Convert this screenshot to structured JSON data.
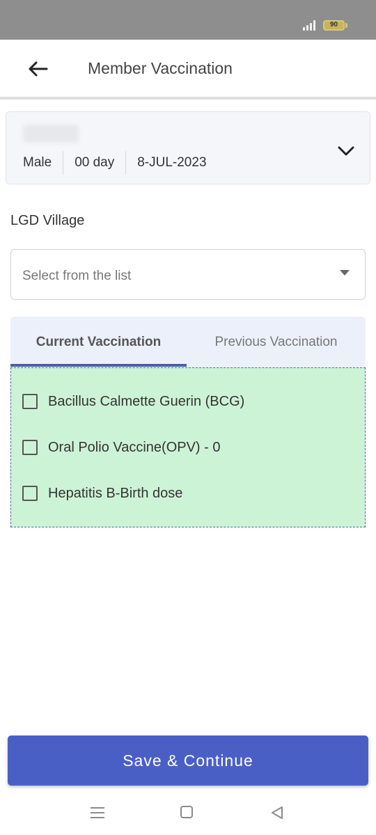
{
  "status_bar": {
    "battery": "90"
  },
  "header": {
    "title": "Member Vaccination"
  },
  "member": {
    "gender": "Male",
    "age": "00 day",
    "dob": "8-JUL-2023"
  },
  "form": {
    "village_label": "LGD Village",
    "village_placeholder": "Select from the list"
  },
  "tabs": [
    {
      "label": "Current Vaccination",
      "active": true
    },
    {
      "label": "Previous Vaccination",
      "active": false
    }
  ],
  "vaccines": [
    {
      "label": "Bacillus Calmette Guerin (BCG)",
      "checked": false
    },
    {
      "label": "Oral Polio Vaccine(OPV) - 0",
      "checked": false
    },
    {
      "label": "Hepatitis B-Birth dose",
      "checked": false
    }
  ],
  "actions": {
    "save_label": "Save & Continue"
  },
  "colors": {
    "primary": "#4a5fc6",
    "panel_bg": "#cdf3d6",
    "tab_bg": "#ebf0fb"
  }
}
